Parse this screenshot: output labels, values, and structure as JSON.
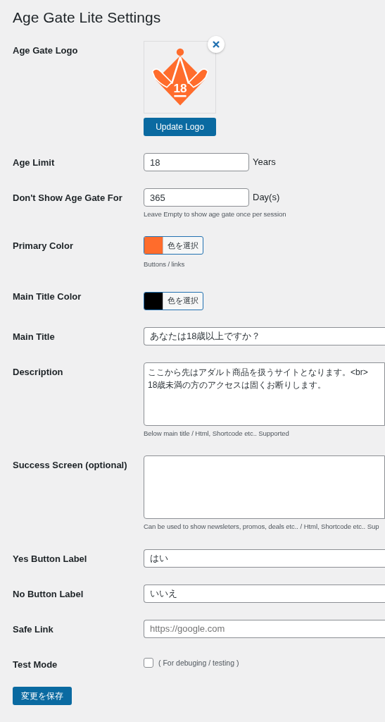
{
  "title": "Age Gate Lite Settings",
  "fields": [
    {
      "kind": "logo",
      "label": "Age Gate Logo",
      "logo_text": "18",
      "button": "Update Logo"
    },
    {
      "kind": "input",
      "label": "Age Limit",
      "value": "18",
      "suffix": "Years"
    },
    {
      "kind": "input",
      "label": "Don't Show Age Gate For",
      "value": "365",
      "suffix": "Day(s)",
      "hint": "Leave Empty to show age gate once per session"
    },
    {
      "kind": "color",
      "label": "Primary Color",
      "color": "#ff6c2c",
      "button": "色を選択",
      "hint": "Buttons / links"
    },
    {
      "kind": "color",
      "label": "Main Title Color",
      "color": "#000000",
      "button": "色を選択"
    },
    {
      "kind": "wide",
      "label": "Main Title",
      "value": "あなたは18歳以上ですか？"
    },
    {
      "kind": "textarea",
      "label": "Description",
      "value": "ここから先はアダルト商品を扱うサイトとなります。<br>\n18歳未満の方のアクセスは固くお断りします。",
      "hint": "Below main title / Html, Shortcode etc.. Supported"
    },
    {
      "kind": "textarea",
      "label": "Success Screen (optional)",
      "hint": "Can be used to show newsleters, promos, deals etc.. / Html, Shortcode etc.. Sup"
    },
    {
      "kind": "wide",
      "label": "Yes Button Label",
      "value": "はい"
    },
    {
      "kind": "wide",
      "label": "No Button Label",
      "value": "いいえ"
    },
    {
      "kind": "wide",
      "label": "Safe Link",
      "placeholder": "https://google.com"
    },
    {
      "kind": "checkbox",
      "label": "Test Mode",
      "checked": false,
      "text": "( For debuging / testing )"
    }
  ],
  "save_button": "変更を保存"
}
